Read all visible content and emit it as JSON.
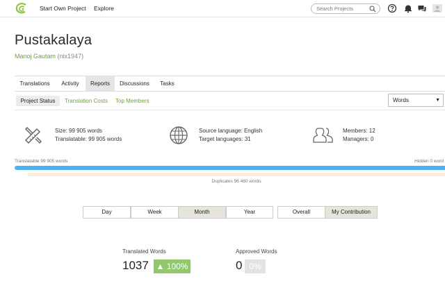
{
  "nav": {
    "start_project": "Start Own Project",
    "explore": "Explore",
    "search_placeholder": "Search Projects"
  },
  "project": {
    "title": "Pustakalaya",
    "owner_name": "Manoj Gautam",
    "owner_handle": "(nix1947)"
  },
  "tabs": [
    {
      "label": "Translations"
    },
    {
      "label": "Activity"
    },
    {
      "label": "Reports",
      "active": true
    },
    {
      "label": "Discussions"
    },
    {
      "label": "Tasks"
    }
  ],
  "subtabs": {
    "status": "Project Status",
    "costs": "Translation Costs",
    "members": "Top Members"
  },
  "unit_select": {
    "selected": "Words"
  },
  "stats": {
    "size": "Size: 99 905 words",
    "translatable": "Translatable: 99 905 words",
    "source_language": "Source language: English",
    "target_languages": "Target languages: 31",
    "members": "Members: 12",
    "managers": "Managers: 0"
  },
  "progress": {
    "translatable_label": "Translatable 99 905 words",
    "hidden_label": "Hidden 0 word",
    "duplicates_label": "Duplicates 96 460 words",
    "accent_color": "#4db3f0",
    "duplicates_color": "#fbeedd"
  },
  "period": {
    "options": [
      "Day",
      "Week",
      "Month",
      "Year"
    ],
    "selected": "Month"
  },
  "scope": {
    "options": [
      "Overall",
      "My Contribution"
    ],
    "selected": "My Contribution"
  },
  "metrics": {
    "translated_label": "Translated Words",
    "translated_value": "1037",
    "translated_change": "▲ 100%",
    "approved_label": "Approved Words",
    "approved_value": "0",
    "approved_change": "0%",
    "green_color": "#92c86b"
  }
}
